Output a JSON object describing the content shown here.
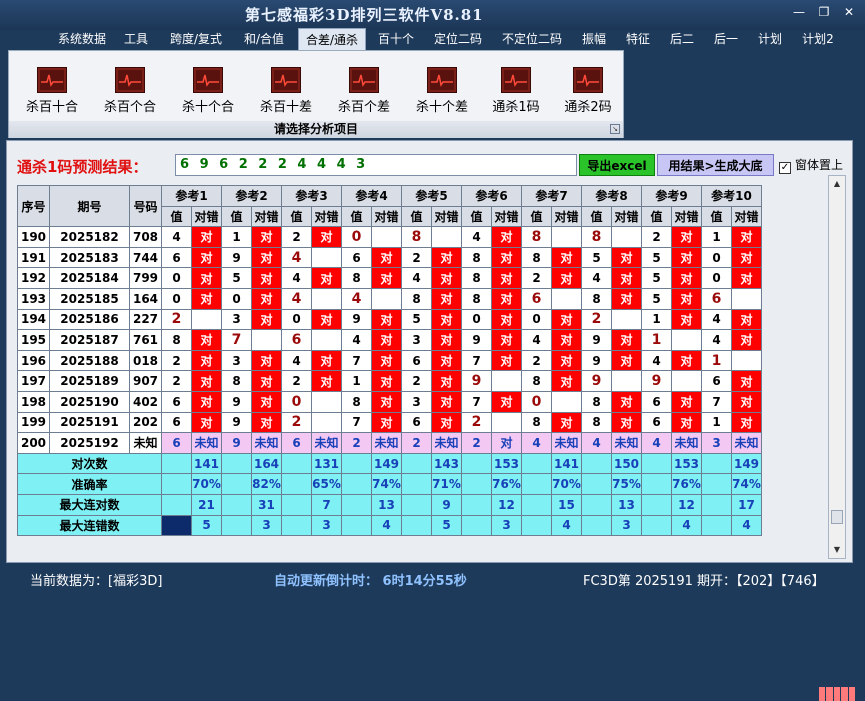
{
  "app": {
    "title": "第七感福彩3D排列三软件V8.81"
  },
  "menu": [
    "系统数据",
    "工具",
    "跨度/复式",
    "和/合值",
    "合差/通杀",
    "百十个",
    "定位二码",
    "不定位二码",
    "振幅",
    "特征",
    "后二",
    "后一",
    "计划",
    "计划2"
  ],
  "menu_active": 4,
  "ribbon": {
    "buttons": [
      "杀百十合",
      "杀百个合",
      "杀十个合",
      "杀百十差",
      "杀百个差",
      "杀十个差",
      "通杀1码",
      "通杀2码"
    ],
    "caption": "请选择分析项目"
  },
  "result": {
    "label": "通杀1码预测结果：",
    "digits": "6 9 6 2 2 2 4 4 4 3",
    "export": "导出excel",
    "generate": "用结果>生成大底",
    "topmost": "窗体置上",
    "topmost_checked": "✓"
  },
  "grid": {
    "head": {
      "seq": "序号",
      "period": "期号",
      "code": "号码",
      "refs": [
        "参考1",
        "参考2",
        "参考3",
        "参考4",
        "参考5",
        "参考6",
        "参考7",
        "参考8",
        "参考9",
        "参考10"
      ],
      "val": "值",
      "hit": "对错"
    },
    "rows": [
      {
        "seq": "190",
        "period": "2025182",
        "code": "708",
        "cells": [
          [
            "4",
            "对"
          ],
          [
            "1",
            "对"
          ],
          [
            "2",
            "对"
          ],
          [
            "0",
            ""
          ],
          [
            "8",
            ""
          ],
          [
            "4",
            "对"
          ],
          [
            "8",
            ""
          ],
          [
            "8",
            ""
          ],
          [
            "2",
            "对"
          ],
          [
            "1",
            "对"
          ]
        ]
      },
      {
        "seq": "191",
        "period": "2025183",
        "code": "744",
        "cells": [
          [
            "6",
            "对"
          ],
          [
            "9",
            "对"
          ],
          [
            "4",
            ""
          ],
          [
            "6",
            "对"
          ],
          [
            "2",
            "对"
          ],
          [
            "8",
            "对"
          ],
          [
            "8",
            "对"
          ],
          [
            "5",
            "对"
          ],
          [
            "5",
            "对"
          ],
          [
            "0",
            "对"
          ]
        ]
      },
      {
        "seq": "192",
        "period": "2025184",
        "code": "799",
        "cells": [
          [
            "0",
            "对"
          ],
          [
            "5",
            "对"
          ],
          [
            "4",
            "对"
          ],
          [
            "8",
            "对"
          ],
          [
            "4",
            "对"
          ],
          [
            "8",
            "对"
          ],
          [
            "2",
            "对"
          ],
          [
            "4",
            "对"
          ],
          [
            "5",
            "对"
          ],
          [
            "0",
            "对"
          ]
        ]
      },
      {
        "seq": "193",
        "period": "2025185",
        "code": "164",
        "cells": [
          [
            "0",
            "对"
          ],
          [
            "0",
            "对"
          ],
          [
            "4",
            ""
          ],
          [
            "4",
            ""
          ],
          [
            "8",
            "对"
          ],
          [
            "8",
            "对"
          ],
          [
            "6",
            ""
          ],
          [
            "8",
            "对"
          ],
          [
            "5",
            "对"
          ],
          [
            "6",
            ""
          ]
        ]
      },
      {
        "seq": "194",
        "period": "2025186",
        "code": "227",
        "cells": [
          [
            "2",
            ""
          ],
          [
            "3",
            "对"
          ],
          [
            "0",
            "对"
          ],
          [
            "9",
            "对"
          ],
          [
            "5",
            "对"
          ],
          [
            "0",
            "对"
          ],
          [
            "0",
            "对"
          ],
          [
            "2",
            ""
          ],
          [
            "1",
            "对"
          ],
          [
            "4",
            "对"
          ]
        ]
      },
      {
        "seq": "195",
        "period": "2025187",
        "code": "761",
        "cells": [
          [
            "8",
            "对"
          ],
          [
            "7",
            ""
          ],
          [
            "6",
            ""
          ],
          [
            "4",
            "对"
          ],
          [
            "3",
            "对"
          ],
          [
            "9",
            "对"
          ],
          [
            "4",
            "对"
          ],
          [
            "9",
            "对"
          ],
          [
            "1",
            ""
          ],
          [
            "4",
            "对"
          ]
        ]
      },
      {
        "seq": "196",
        "period": "2025188",
        "code": "018",
        "cells": [
          [
            "2",
            "对"
          ],
          [
            "3",
            "对"
          ],
          [
            "4",
            "对"
          ],
          [
            "7",
            "对"
          ],
          [
            "6",
            "对"
          ],
          [
            "7",
            "对"
          ],
          [
            "2",
            "对"
          ],
          [
            "9",
            "对"
          ],
          [
            "4",
            "对"
          ],
          [
            "1",
            ""
          ]
        ]
      },
      {
        "seq": "197",
        "period": "2025189",
        "code": "907",
        "cells": [
          [
            "2",
            "对"
          ],
          [
            "8",
            "对"
          ],
          [
            "2",
            "对"
          ],
          [
            "1",
            "对"
          ],
          [
            "2",
            "对"
          ],
          [
            "9",
            ""
          ],
          [
            "8",
            "对"
          ],
          [
            "9",
            ""
          ],
          [
            "9",
            ""
          ],
          [
            "6",
            "对"
          ]
        ]
      },
      {
        "seq": "198",
        "period": "2025190",
        "code": "402",
        "cells": [
          [
            "6",
            "对"
          ],
          [
            "9",
            "对"
          ],
          [
            "0",
            ""
          ],
          [
            "8",
            "对"
          ],
          [
            "3",
            "对"
          ],
          [
            "7",
            "对"
          ],
          [
            "0",
            ""
          ],
          [
            "8",
            "对"
          ],
          [
            "6",
            "对"
          ],
          [
            "7",
            "对"
          ]
        ]
      },
      {
        "seq": "199",
        "period": "2025191",
        "code": "202",
        "cells": [
          [
            "6",
            "对"
          ],
          [
            "9",
            "对"
          ],
          [
            "2",
            ""
          ],
          [
            "7",
            "对"
          ],
          [
            "6",
            "对"
          ],
          [
            "2",
            ""
          ],
          [
            "8",
            "对"
          ],
          [
            "8",
            "对"
          ],
          [
            "6",
            "对"
          ],
          [
            "1",
            "对"
          ]
        ]
      }
    ],
    "pred": {
      "seq": "200",
      "period": "2025192",
      "code": "未知",
      "cells": [
        [
          "6",
          "未知"
        ],
        [
          "9",
          "未知"
        ],
        [
          "6",
          "未知"
        ],
        [
          "2",
          "未知"
        ],
        [
          "2",
          "未知"
        ],
        [
          "2",
          "对"
        ],
        [
          "4",
          "未知"
        ],
        [
          "4",
          "未知"
        ],
        [
          "4",
          "未知"
        ],
        [
          "3",
          "未知"
        ]
      ]
    },
    "stats": [
      {
        "label": "对次数",
        "vals": [
          "141",
          "164",
          "131",
          "149",
          "143",
          "153",
          "141",
          "150",
          "153",
          "149"
        ]
      },
      {
        "label": "准确率",
        "vals": [
          "70%",
          "82%",
          "65%",
          "74%",
          "71%",
          "76%",
          "70%",
          "75%",
          "76%",
          "74%"
        ]
      },
      {
        "label": "最大连对数",
        "vals": [
          "21",
          "31",
          "7",
          "13",
          "9",
          "12",
          "15",
          "13",
          "12",
          "17"
        ]
      },
      {
        "label": "最大连错数",
        "vals": [
          "5",
          "3",
          "3",
          "4",
          "5",
          "3",
          "4",
          "3",
          "4",
          "4"
        ]
      }
    ]
  },
  "status": {
    "left": "当前数据为：[福彩3D]",
    "mid": "自动更新倒计时：  6时14分55秒",
    "right": "FC3D第 2025191 期开：【202】【746】"
  }
}
